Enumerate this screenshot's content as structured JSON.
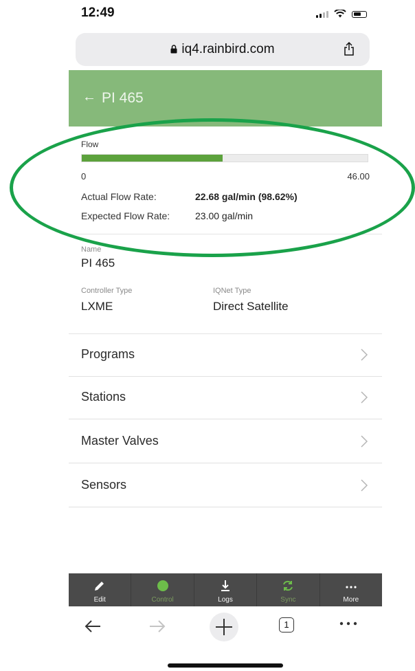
{
  "status_bar": {
    "time": "12:49"
  },
  "browser": {
    "url": "iq4.rainbird.com"
  },
  "header": {
    "back_label": "←",
    "title": "PI 465"
  },
  "flow": {
    "label": "Flow",
    "min_label": "0",
    "max_label": "46.00",
    "fill_fraction": 0.493,
    "actual_label": "Actual Flow Rate:",
    "actual_value": "22.68 gal/min (98.62%)",
    "expected_label": "Expected Flow Rate:",
    "expected_value": "23.00 gal/min"
  },
  "info": {
    "name_caption": "Name",
    "name_value": "PI 465",
    "controller_caption": "Controller Type",
    "controller_value": "LXME",
    "iqnet_caption": "IQNet Type",
    "iqnet_value": "Direct Satellite"
  },
  "menu": [
    {
      "label": "Programs"
    },
    {
      "label": "Stations"
    },
    {
      "label": "Master Valves"
    },
    {
      "label": "Sensors"
    }
  ],
  "toolbar": [
    {
      "label": "Edit",
      "icon": "pencil-icon"
    },
    {
      "label": "Control",
      "icon": "circle-icon"
    },
    {
      "label": "Logs",
      "icon": "download-icon"
    },
    {
      "label": "Sync",
      "icon": "sync-icon"
    },
    {
      "label": "More",
      "icon": "ellipsis-icon"
    }
  ],
  "safari_nav": {
    "tab_count": "1"
  },
  "colors": {
    "header_bg": "#86b97a",
    "flow_fill": "#5ca23c",
    "highlight": "#1aa24a",
    "toolbar_bg": "#4a4a4a",
    "control_green": "#6dbd4a"
  }
}
